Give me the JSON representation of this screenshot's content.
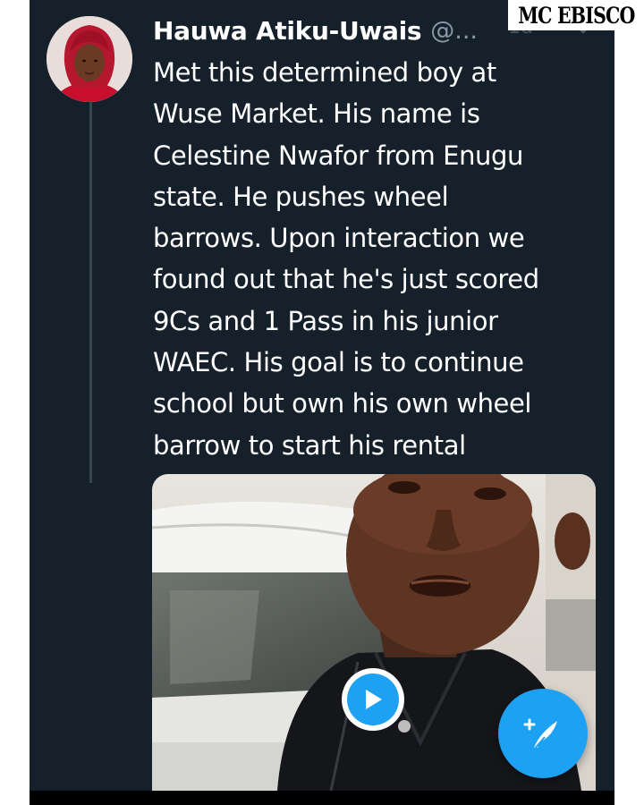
{
  "tweet": {
    "author_name": "Hauwa Atiku-Uwais",
    "handle": "@...",
    "time": "1d",
    "text": "Met this determined boy at\nWuse Market. His name is\nCelestine Nwafor from Enugu\nstate. He pushes wheel\nbarrows. Upon interaction we\nfound out that he's just scored\n9Cs and 1 Pass in his junior\nWAEC. His goal is to continue\nschool but own his own wheel\nbarrow to start his rental"
  },
  "icons": {
    "caret": "chevron-down-icon",
    "play": "play-icon",
    "compose": "compose-tweet-icon"
  },
  "watermark": {
    "text": "MC EBISCO"
  },
  "colors": {
    "background": "#15202b",
    "accent": "#1da1f2",
    "secondary_text": "#8899a6"
  }
}
